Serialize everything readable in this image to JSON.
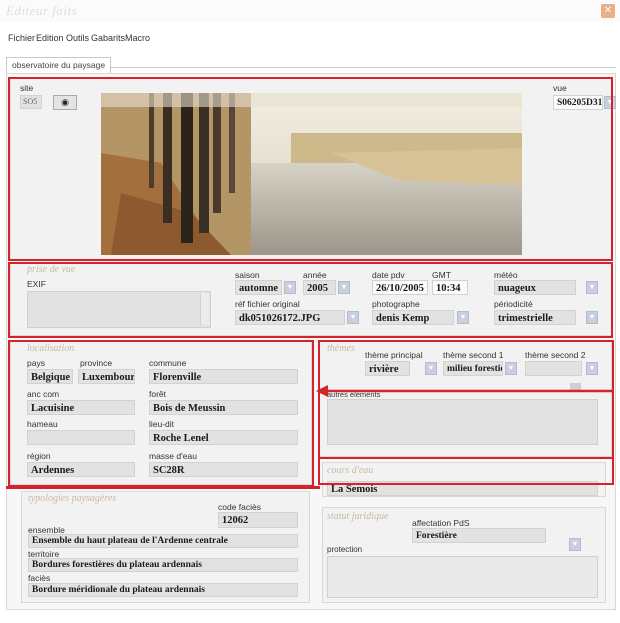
{
  "window": {
    "title": "Editeur faits"
  },
  "menu": [
    "Fichier",
    "Edition",
    "Outils",
    "Gabarits",
    "Macro"
  ],
  "tab": {
    "label": "observatoire du paysage"
  },
  "site": {
    "label": "site",
    "value": "SO5"
  },
  "vue": {
    "label": "vue",
    "value": "S06205D31"
  },
  "prise_de_vue": {
    "title": "prise de vue",
    "exif_label": "EXIF",
    "saison_label": "saison",
    "saison": "automne",
    "annee_label": "année",
    "annee": "2005",
    "date_label": "date pdv",
    "date": "26/10/2005",
    "gmt_label": "GMT",
    "gmt": "10:34",
    "meteo_label": "météo",
    "meteo": "nuageux",
    "fichier_label": "réf fichier original",
    "fichier": "dk051026172.JPG",
    "photographe_label": "photographe",
    "photographe": "denis Kemp",
    "periodicite_label": "périodicité",
    "periodicite": "trimestrielle"
  },
  "localisation": {
    "title": "localisation",
    "pays_label": "pays",
    "pays": "Belgique",
    "province_label": "province",
    "province": "Luxembourg",
    "commune_label": "commune",
    "commune": "Florenville",
    "ancom_label": "anc com",
    "ancom": "Lacuisine",
    "foret_label": "forêt",
    "foret": "Bois de Meussin",
    "hameau_label": "hameau",
    "lieudit_label": "lieu-dit",
    "lieudit": "Roche Lenel",
    "region_label": "région",
    "region": "Ardennes",
    "masse_label": "masse d'eau",
    "masse": "SC28R"
  },
  "themes": {
    "title": "thèmes",
    "principal_label": "thème principal",
    "principal": "rivière",
    "second1_label": "thème second 1",
    "second1": "milieu forestier",
    "second2_label": "thème second 2",
    "autres_label": "autres éléments"
  },
  "cours_eau": {
    "title": "cours d'eau",
    "value": "La Semois"
  },
  "typologies": {
    "title": "typologies paysagères",
    "code_label": "code faciès",
    "code": "12062",
    "ensemble_label": "ensemble",
    "ensemble": "Ensemble du haut plateau de l'Ardenne centrale",
    "territoire_label": "territoire",
    "territoire": "Bordures forestières du plateau ardennais",
    "facies_label": "faciès",
    "facies": "Bordure méridionale du plateau ardennais"
  },
  "statut": {
    "title": "statut juridique",
    "affectation_label": "affectation PdS",
    "affectation": "Forestière",
    "protection_label": "protection"
  },
  "colors": {
    "highlight_red": "#d4232c",
    "field_gray": "#e2e2e2",
    "section_title": "#c8b9a2"
  },
  "icons": [
    "close-icon",
    "eye-icon",
    "dropdown-arrow-icon",
    "left-arrow-icon"
  ]
}
